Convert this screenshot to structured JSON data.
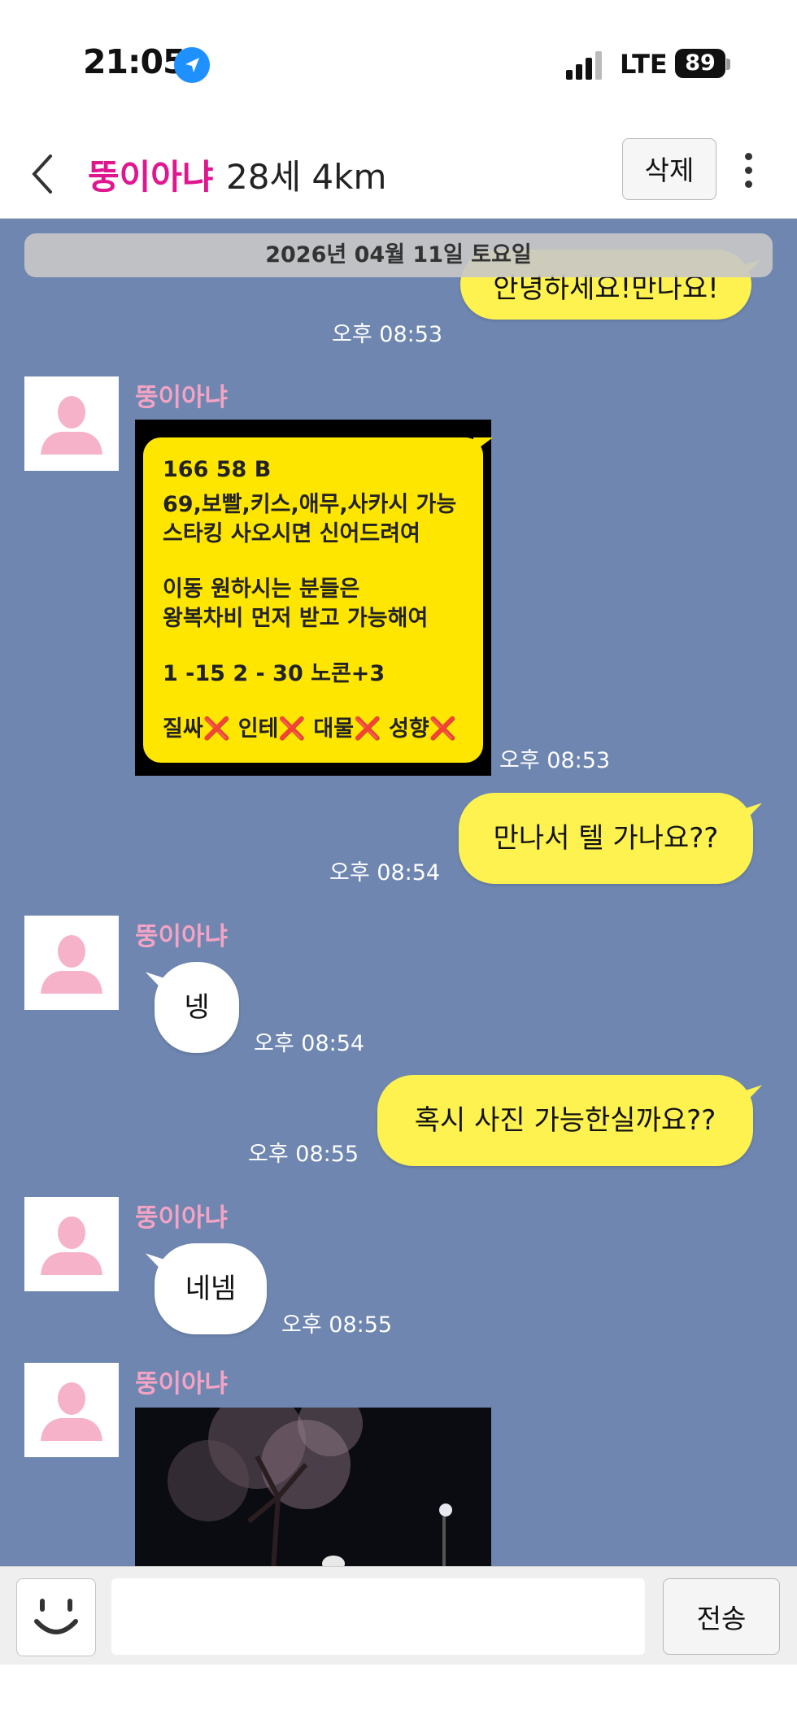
{
  "status_bar": {
    "time": "21:05",
    "network": "LTE",
    "battery": "89"
  },
  "header": {
    "name": "뚱이아냐",
    "meta": "28세 4km",
    "delete_label": "삭제"
  },
  "chat": {
    "date_divider": "2026년 04월 11일 토요일",
    "messages": [
      {
        "from": "me",
        "text": "안녕하세요!만나요!",
        "time": "오후 08:53"
      },
      {
        "from": "them",
        "sender": "뚱이아냐",
        "type": "image",
        "time": "오후 08:53",
        "image_lines": [
          "166 58 B",
          "69,보빨,키스,애무,사카시 가능",
          "스타킹 사오시면 신어드려여",
          "이동 원하시는 분들은",
          "왕복차비 먼저 받고 가능해여",
          "1 -15   2 - 30  노콘+3",
          "질싸❌ 인테❌ 대물❌ 성향❌"
        ]
      },
      {
        "from": "me",
        "text": "만나서 텔 가나요??",
        "time": "오후 08:54"
      },
      {
        "from": "them",
        "sender": "뚱이아냐",
        "text": "넹",
        "time": "오후 08:54"
      },
      {
        "from": "me",
        "text": "혹시 사진 가능한실까요??",
        "time": "오후 08:55"
      },
      {
        "from": "them",
        "sender": "뚱이아냐",
        "text": "네넴",
        "time": "오후 08:55"
      },
      {
        "from": "them",
        "sender": "뚱이아냐",
        "type": "image"
      }
    ]
  },
  "composer": {
    "input_value": "",
    "send_label": "전송"
  },
  "colors": {
    "chat_bg": "#6e86b0",
    "my_bubble": "#fef250",
    "their_bubble": "#ffffff",
    "name_accent": "#e0168f",
    "sender_name": "#f3a3c4"
  }
}
